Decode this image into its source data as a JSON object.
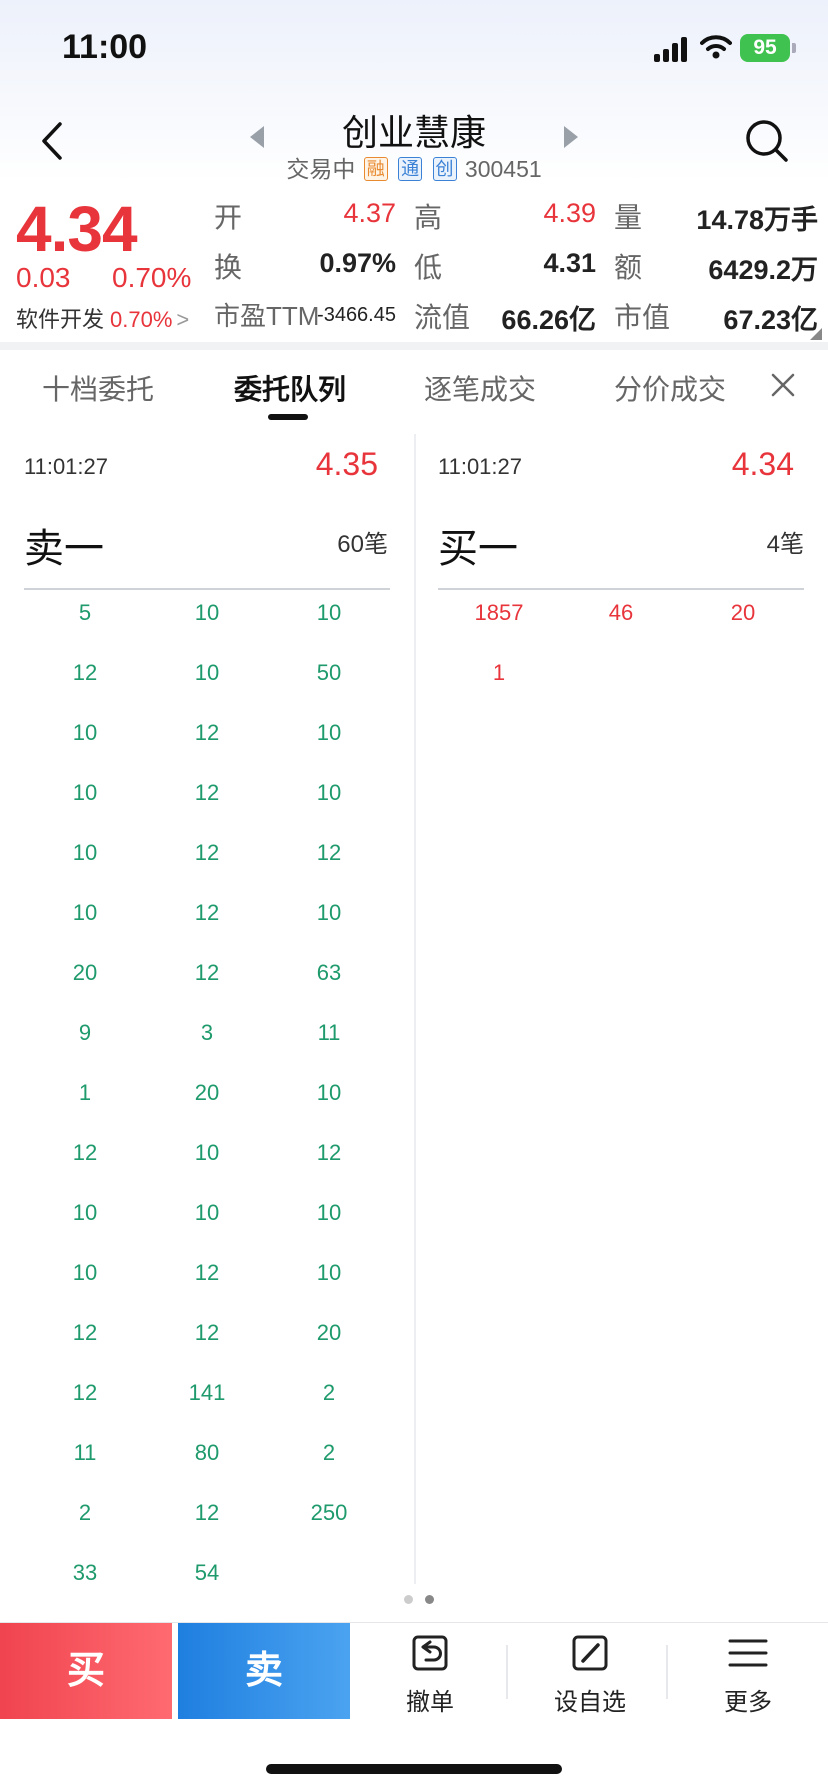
{
  "status": {
    "time": "11:00",
    "battery": "95"
  },
  "header": {
    "name": "创业慧康",
    "trading_status": "交易中",
    "tags": [
      "融",
      "通",
      "创"
    ],
    "code": "300451"
  },
  "quote": {
    "price": "4.34",
    "change": "0.03",
    "change_pct": "0.70%",
    "sector_name": "软件开发",
    "sector_pct": "0.70%",
    "sector_arrow": ">",
    "labels": {
      "open": "开",
      "high": "高",
      "volume": "量",
      "turnover": "换",
      "low": "低",
      "amount": "额",
      "pe": "市盈TTM",
      "float_cap": "流值",
      "market_cap": "市值"
    },
    "open": "4.37",
    "high": "4.39",
    "volume": "14.78万手",
    "turnover": "0.97%",
    "low": "4.31",
    "amount": "6429.2万",
    "pe": "-3466.45",
    "float_cap": "66.26亿",
    "market_cap": "67.23亿"
  },
  "tabs": [
    {
      "label": "十档委托",
      "active": false
    },
    {
      "label": "委托队列",
      "active": true
    },
    {
      "label": "逐笔成交",
      "active": false
    },
    {
      "label": "分价成交",
      "active": false
    }
  ],
  "sell_queue": {
    "time": "11:01:27",
    "price": "4.35",
    "level": "卖一",
    "count": "60笔",
    "rows": [
      [
        "5",
        "10",
        "10"
      ],
      [
        "12",
        "10",
        "50"
      ],
      [
        "10",
        "12",
        "10"
      ],
      [
        "10",
        "12",
        "10"
      ],
      [
        "10",
        "12",
        "12"
      ],
      [
        "10",
        "12",
        "10"
      ],
      [
        "20",
        "12",
        "63"
      ],
      [
        "9",
        "3",
        "11"
      ],
      [
        "1",
        "20",
        "10"
      ],
      [
        "12",
        "10",
        "12"
      ],
      [
        "10",
        "10",
        "10"
      ],
      [
        "10",
        "12",
        "10"
      ],
      [
        "12",
        "12",
        "20"
      ],
      [
        "12",
        "141",
        "2"
      ],
      [
        "11",
        "80",
        "2"
      ],
      [
        "2",
        "12",
        "250"
      ],
      [
        "33",
        "54",
        ""
      ]
    ]
  },
  "buy_queue": {
    "time": "11:01:27",
    "price": "4.34",
    "level": "买一",
    "count": "4笔",
    "rows": [
      [
        "1857",
        "46",
        "20"
      ],
      [
        "1",
        "",
        ""
      ]
    ]
  },
  "bottom_bar": {
    "buy": "买",
    "sell": "卖",
    "cancel": "撤单",
    "watchlist": "设自选",
    "more": "更多"
  }
}
